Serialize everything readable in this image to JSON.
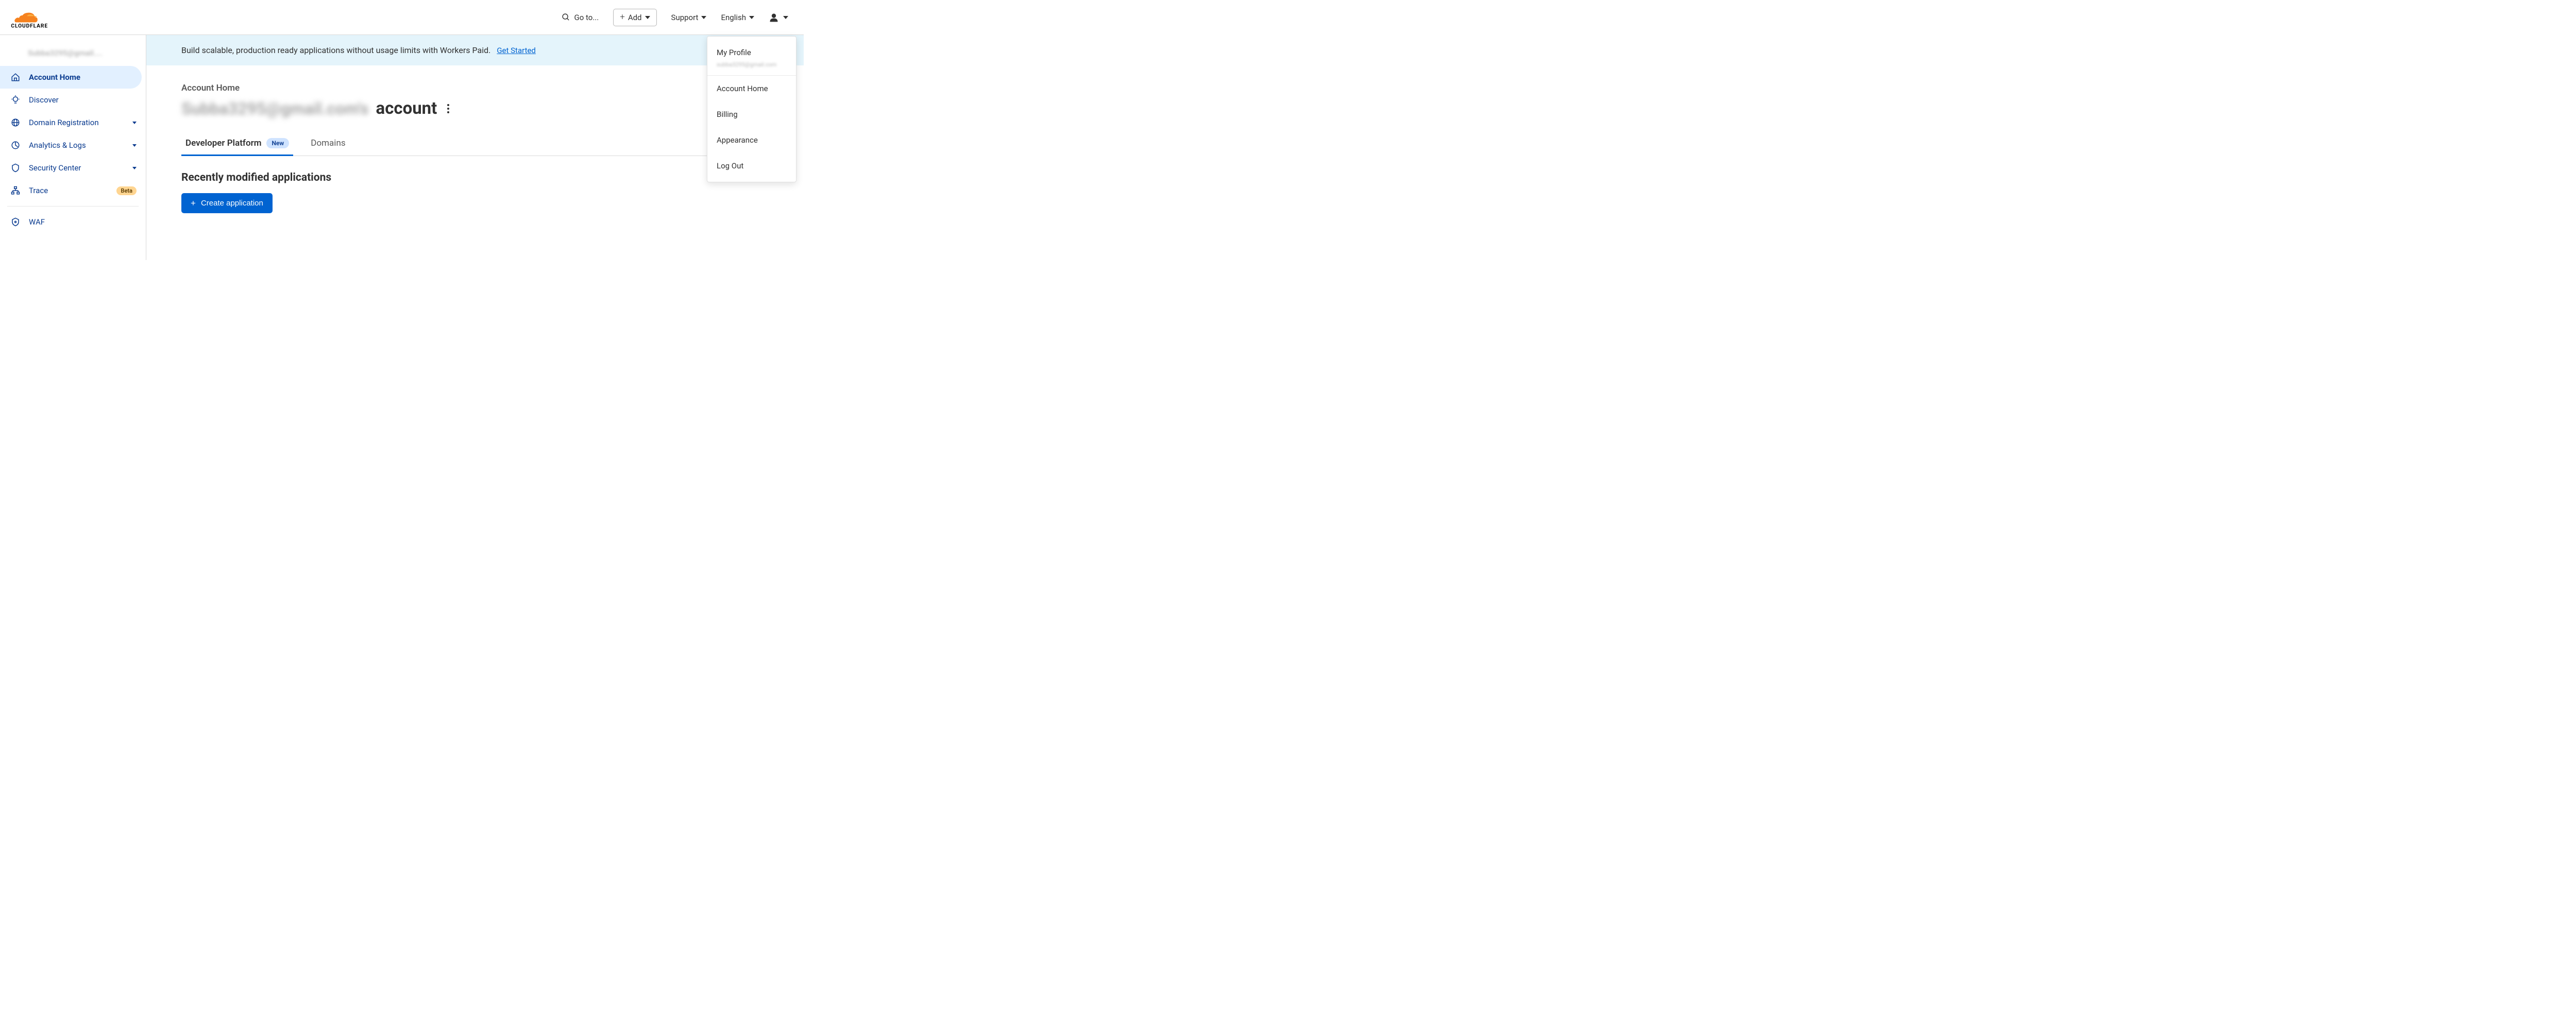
{
  "brand": "CLOUDFLARE",
  "header": {
    "goto": "Go to...",
    "add": "Add",
    "support": "Support",
    "language": "English"
  },
  "sidebar": {
    "email": "Subba3295@gmail....",
    "items": [
      {
        "label": "Account Home",
        "icon": "home-icon",
        "active": true
      },
      {
        "label": "Discover",
        "icon": "lightbulb-icon"
      },
      {
        "label": "Domain Registration",
        "icon": "globe-icon",
        "expandable": true
      },
      {
        "label": "Analytics & Logs",
        "icon": "chart-icon",
        "expandable": true
      },
      {
        "label": "Security Center",
        "icon": "shield-icon",
        "expandable": true
      },
      {
        "label": "Trace",
        "icon": "trace-icon",
        "badge": "Beta"
      }
    ],
    "bottom_item": {
      "label": "WAF",
      "icon": "waf-icon"
    }
  },
  "banner": {
    "text": "Build scalable, production ready applications without usage limits with Workers Paid.",
    "link": "Get Started"
  },
  "page": {
    "crumb": "Account Home",
    "blurred_prefix": "Subba3295@gmail.com's",
    "title": "account",
    "tabs": [
      {
        "label": "Developer Platform",
        "badge": "New",
        "active": true
      },
      {
        "label": "Domains"
      }
    ],
    "section_title": "Recently modified applications",
    "primary_button": "Create application"
  },
  "user_menu": {
    "profile": "My Profile",
    "profile_sub": "subba3295@gmail.com",
    "items": [
      "Account Home",
      "Billing",
      "Appearance",
      "Log Out"
    ]
  }
}
